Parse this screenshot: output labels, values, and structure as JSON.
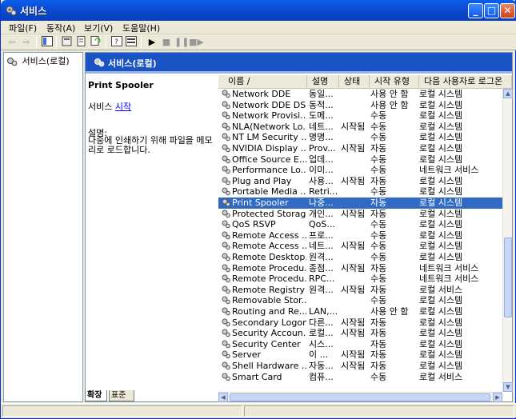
{
  "window": {
    "title": "서비스",
    "accent": "#0a53e0"
  },
  "menu": [
    "파일(F)",
    "동작(A)",
    "보기(V)",
    "도움말(H)"
  ],
  "toolbar": {
    "icons": [
      "back-icon",
      "forward-icon",
      "console-tree-icon",
      "properties-icon",
      "export-icon",
      "refresh-icon",
      "help-icon",
      "show-hide-icon",
      "start-service-icon",
      "stop-service-icon",
      "pause-service-icon",
      "restart-service-icon"
    ]
  },
  "tree": {
    "root": "서비스(로컬)"
  },
  "header": {
    "title": "서비스(로컬)"
  },
  "description": {
    "service_name": "Print Spooler",
    "link_prefix": "서비스 ",
    "link_text": "시작",
    "desc_label": "설명:",
    "desc_text": "나중에 인쇄하기 위해 파일을 메모리로 로드합니다."
  },
  "columns": {
    "name": "이름 ∕",
    "desc": "설명",
    "status": "상태",
    "start": "시작 유형",
    "logon": "다음 사용자로 로그온"
  },
  "rows": [
    {
      "name": "Network DDE",
      "desc": "동일...",
      "status": "",
      "start": "사용 안 함",
      "logon": "로컬 시스템"
    },
    {
      "name": "Network DDE DS...",
      "desc": "동적...",
      "status": "",
      "start": "사용 안 함",
      "logon": "로컬 시스템"
    },
    {
      "name": "Network Provisi...",
      "desc": "도메...",
      "status": "",
      "start": "수동",
      "logon": "로컬 시스템"
    },
    {
      "name": "NLA(Network Lo...",
      "desc": "네트...",
      "status": "시작됨",
      "start": "수동",
      "logon": "로컬 시스템"
    },
    {
      "name": "NT LM Security ...",
      "desc": "명명...",
      "status": "",
      "start": "수동",
      "logon": "로컬 시스템"
    },
    {
      "name": "NVIDIA Display ...",
      "desc": "Prov...",
      "status": "시작됨",
      "start": "자동",
      "logon": "로컬 시스템"
    },
    {
      "name": "Office Source E...",
      "desc": "업데...",
      "status": "",
      "start": "수동",
      "logon": "로컬 시스템"
    },
    {
      "name": "Performance Lo...",
      "desc": "이미...",
      "status": "",
      "start": "수동",
      "logon": "네트워크 서비스"
    },
    {
      "name": "Plug and Play",
      "desc": "사용...",
      "status": "시작됨",
      "start": "자동",
      "logon": "로컬 시스템"
    },
    {
      "name": "Portable Media ...",
      "desc": "Retri...",
      "status": "",
      "start": "수동",
      "logon": "로컬 시스템"
    },
    {
      "name": "Print Spooler",
      "desc": "나중...",
      "status": "",
      "start": "자동",
      "logon": "로컬 시스템",
      "selected": true
    },
    {
      "name": "Protected Storage",
      "desc": "개인...",
      "status": "시작됨",
      "start": "자동",
      "logon": "로컬 시스템"
    },
    {
      "name": "QoS RSVP",
      "desc": "QoS...",
      "status": "",
      "start": "수동",
      "logon": "로컬 시스템"
    },
    {
      "name": "Remote Access ...",
      "desc": "프로...",
      "status": "",
      "start": "수동",
      "logon": "로컬 시스템"
    },
    {
      "name": "Remote Access ...",
      "desc": "네트...",
      "status": "시작됨",
      "start": "수동",
      "logon": "로컬 시스템"
    },
    {
      "name": "Remote Desktop...",
      "desc": "원격...",
      "status": "",
      "start": "수동",
      "logon": "로컬 시스템"
    },
    {
      "name": "Remote Procedu...",
      "desc": "종점...",
      "status": "시작됨",
      "start": "자동",
      "logon": "네트워크 서비스"
    },
    {
      "name": "Remote Procedu...",
      "desc": "RPC...",
      "status": "",
      "start": "수동",
      "logon": "네트워크 서비스"
    },
    {
      "name": "Remote Registry",
      "desc": "원격...",
      "status": "시작됨",
      "start": "자동",
      "logon": "로컬 서비스"
    },
    {
      "name": "Removable Stor...",
      "desc": "",
      "status": "",
      "start": "수동",
      "logon": "로컬 시스템"
    },
    {
      "name": "Routing and Re...",
      "desc": "LAN,...",
      "status": "",
      "start": "사용 안 함",
      "logon": "로컬 시스템"
    },
    {
      "name": "Secondary Logon",
      "desc": "다른...",
      "status": "시작됨",
      "start": "자동",
      "logon": "로컬 시스템"
    },
    {
      "name": "Security Accoun...",
      "desc": "로컬...",
      "status": "시작됨",
      "start": "자동",
      "logon": "로컬 시스템"
    },
    {
      "name": "Security Center",
      "desc": "시스...",
      "status": "",
      "start": "자동",
      "logon": "로컬 시스템"
    },
    {
      "name": "Server",
      "desc": "이 ...",
      "status": "시작됨",
      "start": "자동",
      "logon": "로컬 시스템"
    },
    {
      "name": "Shell Hardware ...",
      "desc": "자동...",
      "status": "시작됨",
      "start": "자동",
      "logon": "로컬 시스템"
    },
    {
      "name": "Smart Card",
      "desc": "컴퓨...",
      "status": "",
      "start": "수동",
      "logon": "로컬 서비스"
    }
  ],
  "tabs": [
    "확장",
    "표준"
  ]
}
